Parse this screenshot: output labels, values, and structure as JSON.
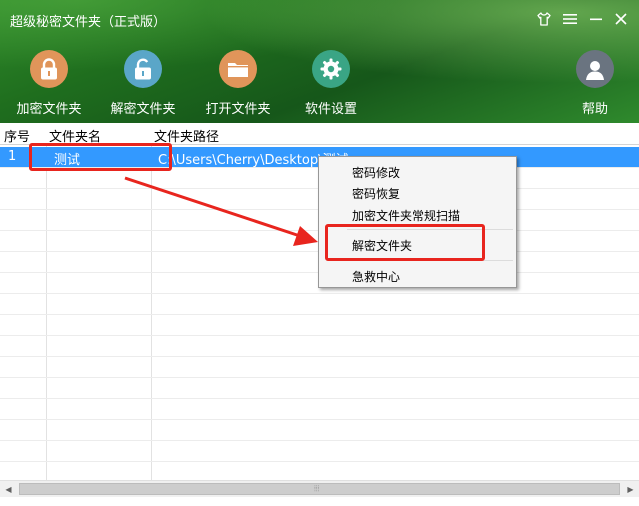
{
  "window": {
    "title": "超级秘密文件夹（正式版）",
    "controls": [
      "shirt-icon",
      "menu-icon",
      "minimize-icon",
      "close-icon"
    ]
  },
  "toolbar": {
    "encrypt_label": "加密文件夹",
    "decrypt_label": "解密文件夹",
    "open_label": "打开文件夹",
    "settings_label": "软件设置",
    "help_label": "帮助"
  },
  "table": {
    "columns": [
      "序号",
      "文件夹名",
      "文件夹路径"
    ],
    "rows": [
      {
        "no": "1",
        "name": "测试",
        "path": "C:\\Users\\Cherry\\Desktop\\测试",
        "selected": true
      }
    ]
  },
  "context_menu": {
    "items": [
      "密码修改",
      "密码恢复",
      "加密文件夹常规扫描",
      "解密文件夹",
      "急救中心"
    ]
  },
  "colors": {
    "header_green": "#1f6e1e",
    "selection_blue": "#3399ff",
    "annotation_red": "#e8251e",
    "lock_orange": "#e0955a",
    "unlock_teal": "#5aa6c8",
    "settings_green": "#3aa585",
    "help_gray": "#6a7480"
  },
  "scrollbar": {
    "grip": "⦙⦙⦙"
  }
}
